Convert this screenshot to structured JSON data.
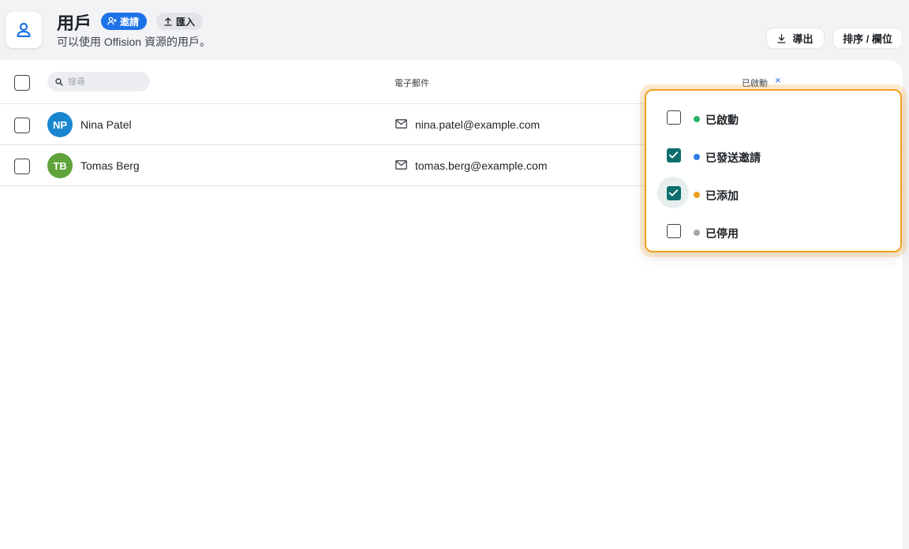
{
  "header": {
    "title": "用戶",
    "subtitle": "可以使用 Offision 資源的用戶。",
    "invite_label": "邀請",
    "import_label": "匯入",
    "export_label": "導出",
    "sort_label": "排序 / 欄位"
  },
  "table": {
    "search_placeholder": "搜尋",
    "columns": {
      "email": "電子郵件",
      "status": "已啟動",
      "status_clear": "×"
    },
    "rows": [
      {
        "initials": "NP",
        "name": "Nina Patel",
        "email": "nina.patel@example.com",
        "avatar_color": "#1a86d0"
      },
      {
        "initials": "TB",
        "name": "Tomas Berg",
        "email": "tomas.berg@example.com",
        "avatar_color": "#5fa33a"
      }
    ]
  },
  "status_filter": {
    "options": [
      {
        "label": "已啟動",
        "checked": false,
        "dot_color": "#27b36a"
      },
      {
        "label": "已發送邀請",
        "checked": true,
        "dot_color": "#2f7be6"
      },
      {
        "label": "已添加",
        "checked": true,
        "dot_color": "#f0a020",
        "focused": true
      },
      {
        "label": "已停用",
        "checked": false,
        "dot_color": "#a3a6ab"
      }
    ]
  },
  "colors": {
    "accent": "#1e72e8",
    "check": "#0d6e6e",
    "focus_border": "#f0a020"
  }
}
